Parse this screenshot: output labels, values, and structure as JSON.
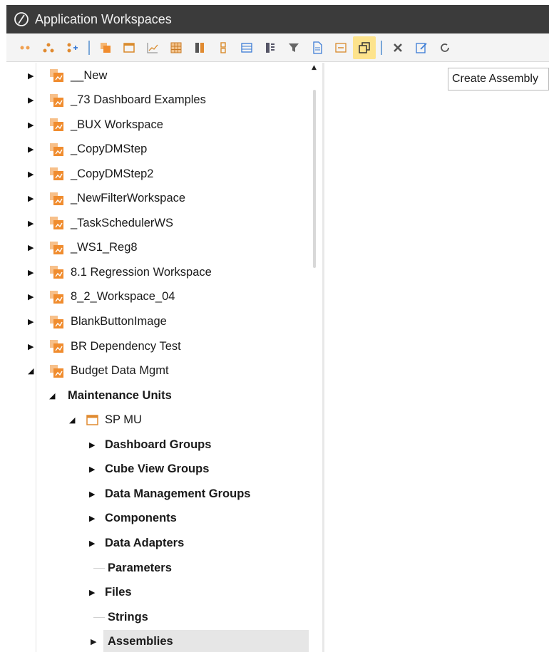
{
  "window": {
    "title": "Application Workspaces"
  },
  "toolbar": {
    "icons": [
      "expand-dots-icon",
      "hierarchy-icon",
      "add-node-icon",
      "workspace-icon",
      "calendar-icon",
      "line-chart-icon",
      "grid-icon",
      "stack-icon",
      "vertical-list-icon",
      "table-icon",
      "columns-icon",
      "filter-icon",
      "document-icon",
      "collapse-icon",
      "create-assembly-icon",
      "delete-icon",
      "edit-icon",
      "refresh-icon"
    ],
    "tooltip": "Create Assembly"
  },
  "tree": {
    "items": [
      {
        "label": "__New",
        "level": 0,
        "expanded": false
      },
      {
        "label": "_73 Dashboard Examples",
        "level": 0,
        "expanded": false
      },
      {
        "label": "_BUX Workspace",
        "level": 0,
        "expanded": false
      },
      {
        "label": "_CopyDMStep",
        "level": 0,
        "expanded": false
      },
      {
        "label": "_CopyDMStep2",
        "level": 0,
        "expanded": false
      },
      {
        "label": "_NewFilterWorkspace",
        "level": 0,
        "expanded": false
      },
      {
        "label": "_TaskSchedulerWS",
        "level": 0,
        "expanded": false
      },
      {
        "label": "_WS1_Reg8",
        "level": 0,
        "expanded": false
      },
      {
        "label": "8.1 Regression Workspace",
        "level": 0,
        "expanded": false
      },
      {
        "label": "8_2_Workspace_04",
        "level": 0,
        "expanded": false
      },
      {
        "label": "BlankButtonImage",
        "level": 0,
        "expanded": false
      },
      {
        "label": "BR Dependency Test",
        "level": 0,
        "expanded": false
      },
      {
        "label": "Budget Data Mgmt",
        "level": 0,
        "expanded": true
      },
      {
        "label": "Maintenance Units",
        "level": 1,
        "expanded": true
      },
      {
        "label": "SP MU",
        "level": 2,
        "expanded": true
      },
      {
        "label": "Dashboard Groups",
        "level": 3,
        "expanded": false
      },
      {
        "label": "Cube View Groups",
        "level": 3,
        "expanded": false
      },
      {
        "label": "Data Management Groups",
        "level": 3,
        "expanded": false
      },
      {
        "label": "Components",
        "level": 3,
        "expanded": false
      },
      {
        "label": "Data Adapters",
        "level": 3,
        "expanded": false
      },
      {
        "label": "Parameters",
        "level": 3,
        "expanded": false
      },
      {
        "label": "Files",
        "level": 3,
        "expanded": false
      },
      {
        "label": "Strings",
        "level": 3,
        "expanded": false
      },
      {
        "label": "Assemblies",
        "level": 3,
        "expanded": false,
        "selected": true
      }
    ]
  },
  "colors": {
    "titlebar": "#3b3b3b",
    "workspace_icon": "#f39a3c",
    "selected_row": "#e6e6e6",
    "active_tool": "#fde38c"
  }
}
